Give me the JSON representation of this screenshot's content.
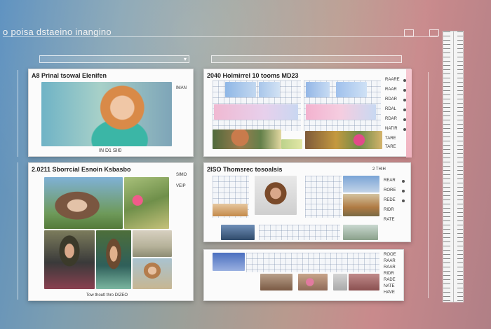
{
  "app": {
    "title": "o poisa dstaeino inangino"
  },
  "colors": {
    "background_left": "#5a8fbf",
    "background_right": "#c98a8c",
    "panel": "#fbfbfb"
  },
  "icons": [
    "window-icon",
    "window-icon-2",
    "dropdown-chevron-icon",
    "ruler-icon"
  ],
  "panels": {
    "p1": {
      "title": "A8 Prinal tsowal Elenifen",
      "side_label": "IMAN",
      "caption": "IN  D1 SII0"
    },
    "p2": {
      "title": "2040 Holmirrel  10 tooms MD23",
      "side": [
        "RAARE",
        "RAAR",
        "RDAR",
        "RDAL",
        "RDAR",
        "NATIR",
        "TARE",
        "TARE"
      ]
    },
    "p3": {
      "title": "2.0211 Sborrcial  Esnoin Ksbasbo",
      "side_label": "SIMO",
      "side_label2": "VEIP",
      "caption": "Tow thoutl thro DIZEO"
    },
    "p4": {
      "title": "2ISO Thomsrec  tosoalsis",
      "side_label": "2 THIH",
      "side": [
        "REAR",
        "RORE",
        "REDE",
        "RIDR",
        "RATE"
      ]
    },
    "p5": {
      "side": [
        "ROOE",
        "RAAR",
        "RAAR",
        "RIDR",
        "RADE",
        "NATE",
        "HAVE"
      ]
    }
  }
}
